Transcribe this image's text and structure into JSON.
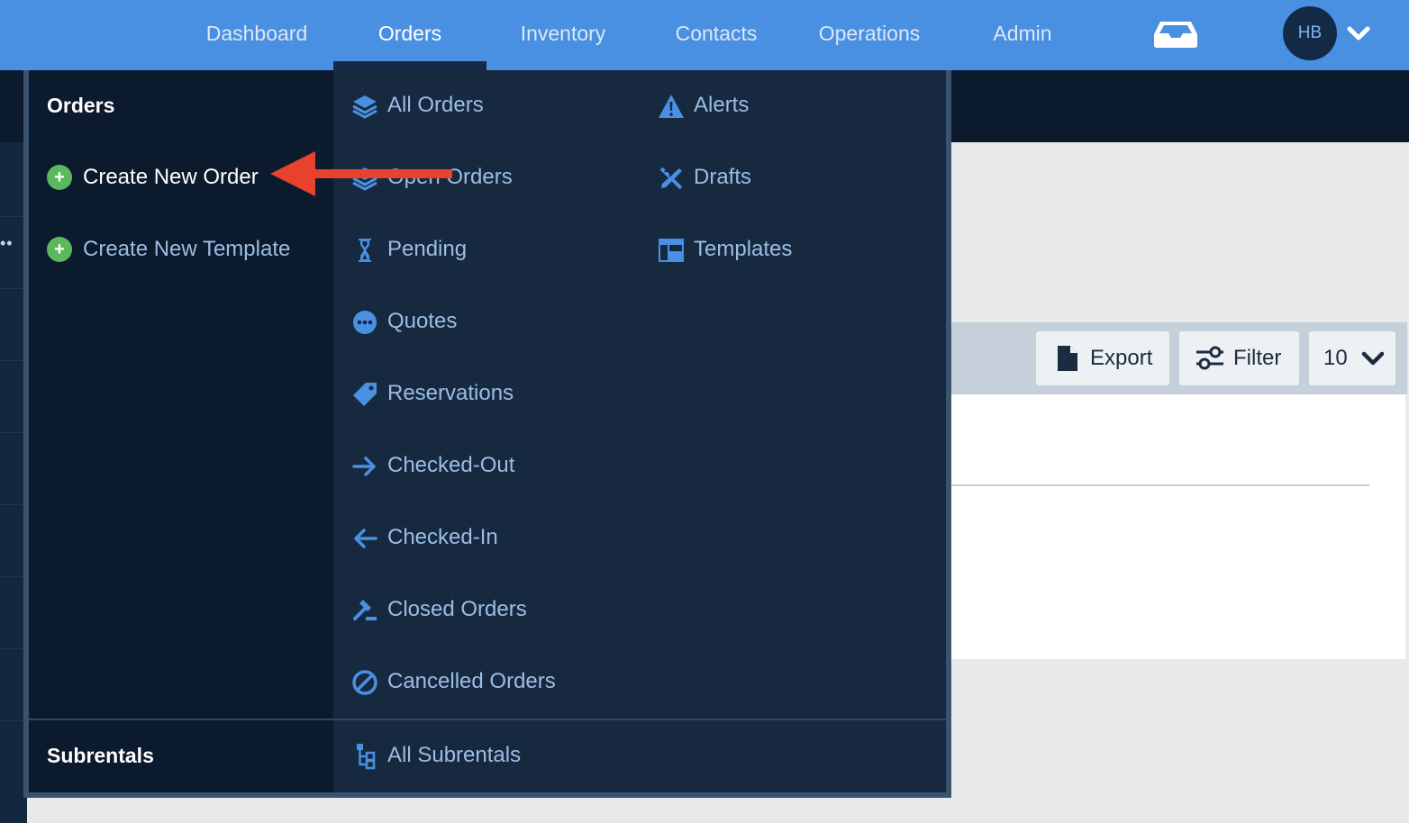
{
  "topnav": {
    "items": [
      {
        "label": "Dashboard",
        "active": false
      },
      {
        "label": "Orders",
        "active": true
      },
      {
        "label": "Inventory",
        "active": false
      },
      {
        "label": "Contacts",
        "active": false
      },
      {
        "label": "Operations",
        "active": false
      },
      {
        "label": "Admin",
        "active": false
      }
    ],
    "inbox_icon": "inbox-icon",
    "avatar_initials": "HB",
    "account_menu_icon": "chevron-down-icon"
  },
  "toolbar": {
    "export_label": "Export",
    "filter_label": "Filter",
    "page_size": "10"
  },
  "mega_menu": {
    "orders_heading": "Orders",
    "actions": [
      {
        "label": "Create New Order",
        "icon": "plus-circle-icon"
      },
      {
        "label": "Create New Template",
        "icon": "plus-circle-icon"
      }
    ],
    "order_links_col1": [
      {
        "label": "All Orders",
        "icon": "layers-icon"
      },
      {
        "label": "Open Orders",
        "icon": "layers-icon"
      },
      {
        "label": "Pending",
        "icon": "hourglass-icon"
      },
      {
        "label": "Quotes",
        "icon": "ellipsis-circle-icon"
      },
      {
        "label": "Reservations",
        "icon": "tag-icon"
      },
      {
        "label": "Checked-Out",
        "icon": "arrow-right-icon"
      },
      {
        "label": "Checked-In",
        "icon": "arrow-left-icon"
      },
      {
        "label": "Closed Orders",
        "icon": "gavel-icon"
      },
      {
        "label": "Cancelled Orders",
        "icon": "ban-icon"
      }
    ],
    "order_links_col2": [
      {
        "label": "Alerts",
        "icon": "warning-icon"
      },
      {
        "label": "Drafts",
        "icon": "pencil-ruler-icon"
      },
      {
        "label": "Templates",
        "icon": "table-icon"
      }
    ],
    "subrentals_heading": "Subrentals",
    "subrental_links": [
      {
        "label": "All Subrentals",
        "icon": "sitemap-icon"
      }
    ]
  },
  "annotation": {
    "icon": "red-arrow-icon",
    "color": "#e8412c"
  },
  "colors": {
    "nav_bar": "#4a90e2",
    "menu_dark": "#0b1a2c",
    "menu_panel": "#16293f",
    "link_text": "#9cbde3",
    "icon_blue": "#4a90e2",
    "plus_green": "#5cb85c"
  }
}
